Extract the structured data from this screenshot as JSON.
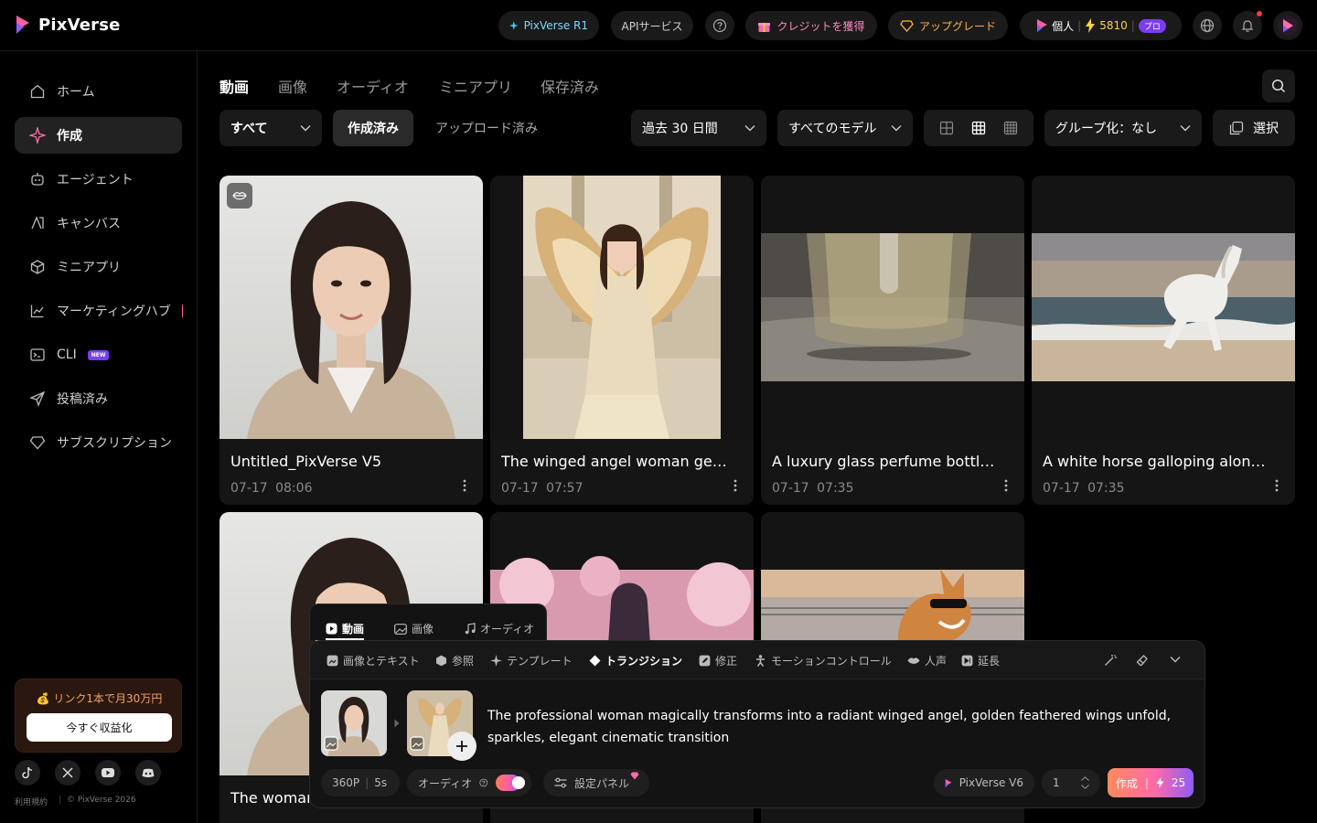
{
  "header": {
    "brand": "PixVerse",
    "r1_label": "PixVerse R1",
    "api_label": "APIサービス",
    "credits_label": "クレジットを獲得",
    "upgrade_label": "アップグレード",
    "plan_label": "個人",
    "credits_count": "5810",
    "pro_badge": "プロ"
  },
  "sidebar": {
    "items": [
      {
        "label": "ホーム"
      },
      {
        "label": "作成"
      },
      {
        "label": "エージェント"
      },
      {
        "label": "キャンバス"
      },
      {
        "label": "ミニアプリ"
      },
      {
        "label": "マーケティングハブ"
      },
      {
        "label": "CLI",
        "badge": "NEW"
      },
      {
        "label": "投稿済み"
      },
      {
        "label": "サブスクリプション"
      }
    ],
    "promo_text": "💰 リンク1本で月30万円",
    "promo_button": "今すぐ収益化",
    "footer_terms": "利用規約",
    "footer_copyright": "© PixVerse 2026"
  },
  "tabs": [
    "動画",
    "画像",
    "オーディオ",
    "ミニアプリ",
    "保存済み"
  ],
  "filters": {
    "type_select": "すべて",
    "created_label": "作成済み",
    "uploaded_label": "アップロード済み",
    "date_select": "過去 30 日間",
    "model_select": "すべてのモデル",
    "group_select": "グループ化：なし",
    "select_label": "選択"
  },
  "cards": [
    {
      "title": "Untitled_PixVerse V5",
      "date": "07-17  08:06"
    },
    {
      "title": "The winged angel woman gent...",
      "date": "07-17  07:57"
    },
    {
      "title": "A luxury glass perfume bottle_...",
      "date": "07-17  07:35"
    },
    {
      "title": "A white horse galloping along...",
      "date": "07-17  07:35"
    },
    {
      "title": "The woman",
      "date": ""
    }
  ],
  "composer": {
    "tabs": [
      "動画",
      "画像",
      "オーディオ"
    ],
    "modes": [
      "画像とテキスト",
      "参照",
      "テンプレート",
      "トランジション",
      "修正",
      "モーションコントロール",
      "人声",
      "延長"
    ],
    "prompt": "The professional woman magically transforms into a radiant winged angel, golden feathered wings unfold, sparkles, elegant cinematic transition",
    "resolution": "360P",
    "duration": "5s",
    "audio_label": "オーディオ",
    "settings_label": "設定パネル",
    "model_label": "PixVerse V6",
    "quantity": "1",
    "create_label": "作成",
    "cost": "25"
  },
  "colors": {
    "accent": "#7b3df2",
    "promo": "#f5a15f",
    "credit": "#ffd23f"
  }
}
